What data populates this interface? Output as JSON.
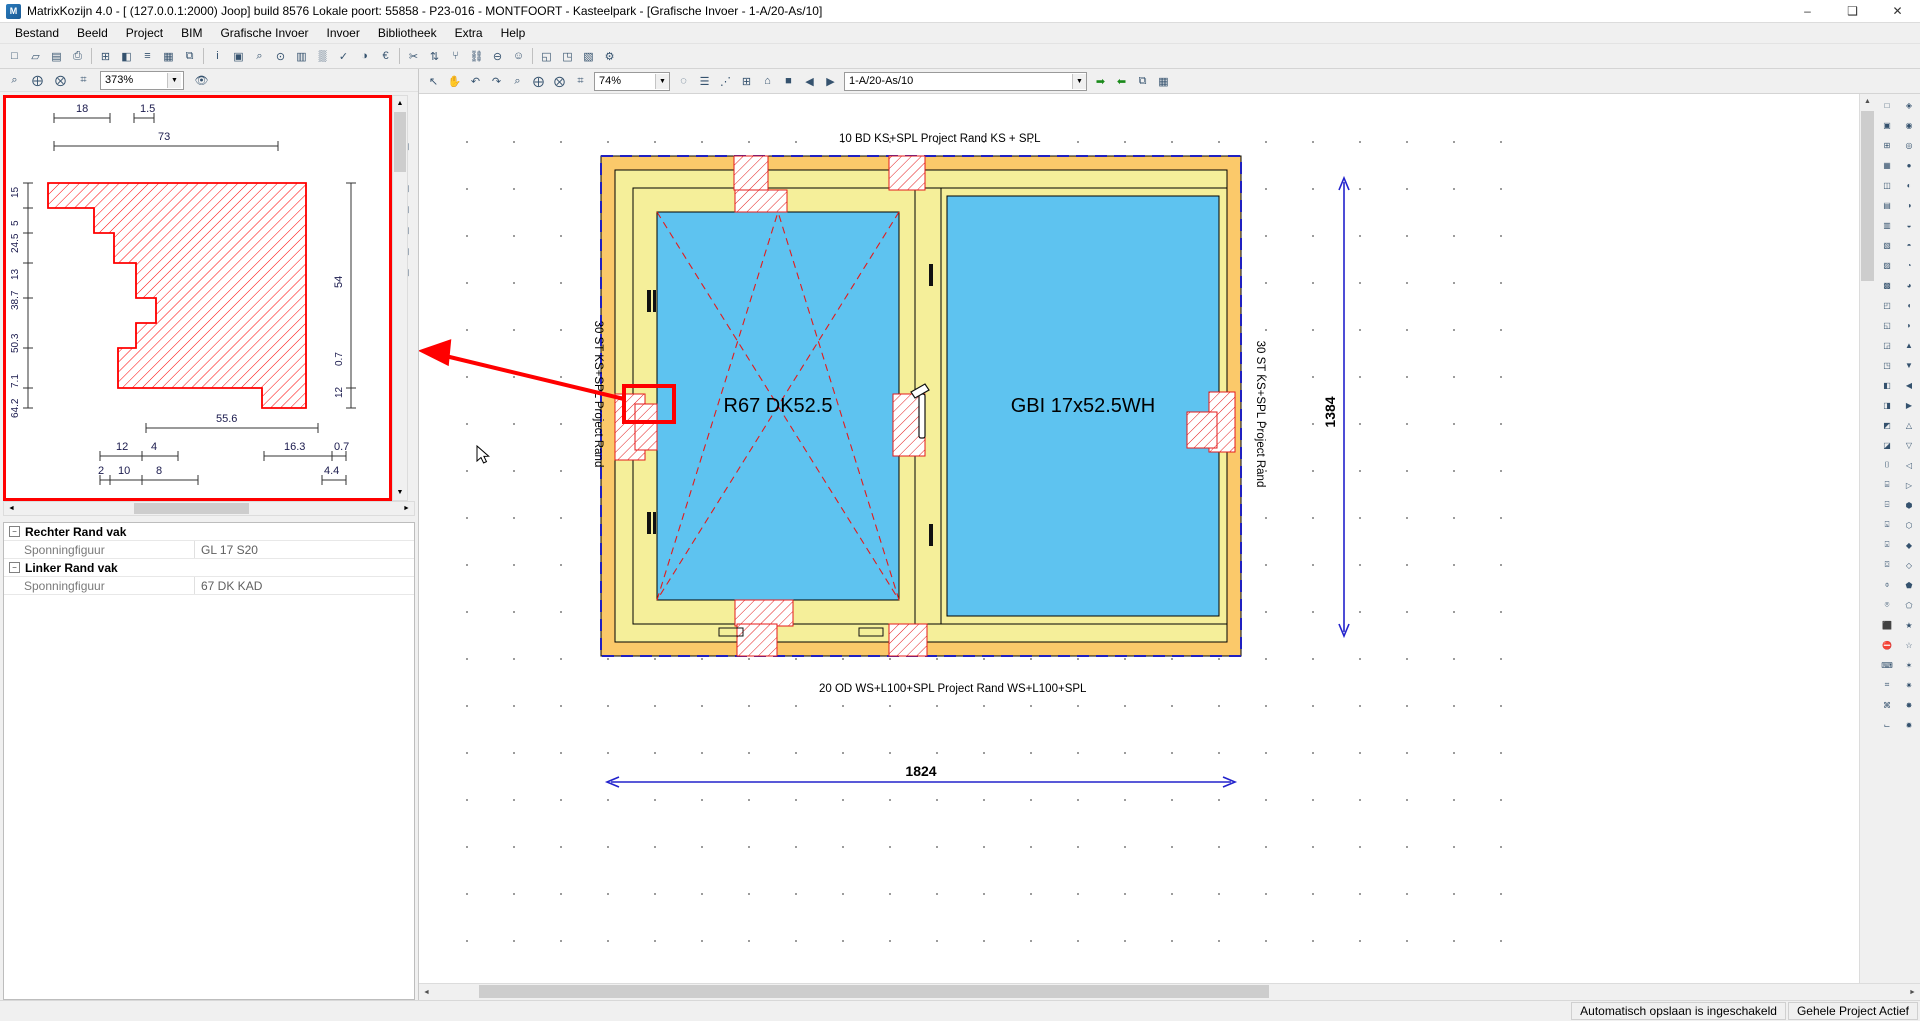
{
  "window": {
    "title": "MatrixKozijn 4.0 - [ (127.0.0.1:2000) Joop] build  8576 Lokale poort: 55858 - P23-016 - MONTFOORT - Kasteelpark - [Grafische Invoer - 1-A/20-As/10]",
    "app_icon": "app-icon",
    "minimize": "–",
    "maximize": "❑",
    "close": "✕"
  },
  "menubar": {
    "items": [
      {
        "label": "Bestand"
      },
      {
        "label": "Beeld"
      },
      {
        "label": "Project"
      },
      {
        "label": "BIM"
      },
      {
        "label": "Grafische Invoer"
      },
      {
        "label": "Invoer"
      },
      {
        "label": "Bibliotheek"
      },
      {
        "label": "Extra"
      },
      {
        "label": "Help"
      }
    ]
  },
  "main_toolbar": {
    "buttons": [
      {
        "name": "new-document-icon",
        "glyph": "□"
      },
      {
        "name": "open-folder-icon",
        "glyph": "▱"
      },
      {
        "name": "save-icon",
        "glyph": "▤"
      },
      {
        "name": "print-icon",
        "glyph": "⎙"
      },
      {
        "name": "sep",
        "glyph": ""
      },
      {
        "name": "grid-view-icon",
        "glyph": "⊞"
      },
      {
        "name": "chart-icon",
        "glyph": "◧"
      },
      {
        "name": "list-icon",
        "glyph": "≡"
      },
      {
        "name": "table-icon",
        "glyph": "▦"
      },
      {
        "name": "copy-icon",
        "glyph": "⧉"
      },
      {
        "name": "sep",
        "glyph": ""
      },
      {
        "name": "info-icon",
        "glyph": "i"
      },
      {
        "name": "calculator-icon",
        "glyph": "▣"
      },
      {
        "name": "zoom-page-icon",
        "glyph": "⌕"
      },
      {
        "name": "search-doc-icon",
        "glyph": "⊙"
      },
      {
        "name": "report-icon",
        "glyph": "▥"
      },
      {
        "name": "color-icon",
        "glyph": "▒"
      },
      {
        "name": "spell-icon",
        "glyph": "✓"
      },
      {
        "name": "palette-icon",
        "glyph": "◑"
      },
      {
        "name": "euro-icon",
        "glyph": "€"
      },
      {
        "name": "sep",
        "glyph": ""
      },
      {
        "name": "cut-icon",
        "glyph": "✂"
      },
      {
        "name": "sort-icon",
        "glyph": "⇅"
      },
      {
        "name": "tree-icon",
        "glyph": "⑂"
      },
      {
        "name": "link-icon",
        "glyph": "⛓"
      },
      {
        "name": "attach-icon",
        "glyph": "⊖"
      },
      {
        "name": "user-icon",
        "glyph": "☺"
      },
      {
        "name": "sep",
        "glyph": ""
      },
      {
        "name": "window-icon",
        "glyph": "◱"
      },
      {
        "name": "export-icon",
        "glyph": "◳"
      },
      {
        "name": "note-icon",
        "glyph": "▧"
      },
      {
        "name": "gear-icon",
        "glyph": "⚙"
      }
    ]
  },
  "left_panel": {
    "toolbar": [
      {
        "name": "zoom-extents-icon",
        "glyph": "⌕"
      },
      {
        "name": "zoom-in-icon",
        "glyph": "⨁"
      },
      {
        "name": "zoom-out-icon",
        "glyph": "⨂"
      },
      {
        "name": "zoom-window-icon",
        "glyph": "⌗"
      }
    ],
    "zoom_value": "373%",
    "eye_icon": "eye-icon",
    "profile_drawing": {
      "top_dims": [
        "18",
        "1.5",
        "73"
      ],
      "left_dims": [
        "15",
        "5",
        "24.5",
        "13",
        "38.7",
        "50.3",
        "7.1",
        "64.2"
      ],
      "right_dims": [
        "54",
        "0.7",
        "12"
      ],
      "bottom_dims_row1": [
        "55.6"
      ],
      "bottom_dims_row2": [
        "12",
        "4",
        "16.3",
        "0.7"
      ],
      "bottom_dims_row3": [
        "2",
        "10",
        "8",
        "4.4"
      ]
    }
  },
  "properties": {
    "groups": [
      {
        "title": "Rechter Rand vak",
        "expander": "−",
        "rows": [
          {
            "key": "Sponningfiguur",
            "value": "GL 17 S20"
          }
        ]
      },
      {
        "title": "Linker Rand vak",
        "expander": "−",
        "rows": [
          {
            "key": "Sponningfiguur",
            "value": "67 DK KAD"
          }
        ]
      }
    ]
  },
  "draw_toolbar": {
    "left_buttons": [
      {
        "name": "select-arrow-icon",
        "glyph": "↖"
      },
      {
        "name": "pan-hand-icon",
        "glyph": "✋"
      },
      {
        "name": "undo-icon",
        "glyph": "↶"
      },
      {
        "name": "redo-icon",
        "glyph": "↷"
      },
      {
        "name": "zoom-extents-icon",
        "glyph": "⌕"
      },
      {
        "name": "zoom-in-icon",
        "glyph": "⨁"
      },
      {
        "name": "zoom-out-icon",
        "glyph": "⨂"
      },
      {
        "name": "zoom-window-icon",
        "glyph": "⌗"
      }
    ],
    "zoom_value": "74%",
    "mid_buttons": [
      {
        "name": "globe-icon",
        "glyph": "◌"
      },
      {
        "name": "layers-icon",
        "glyph": "☰"
      },
      {
        "name": "grid-snap-icon",
        "glyph": "⋰"
      },
      {
        "name": "grid-icon",
        "glyph": "⊞"
      },
      {
        "name": "home-icon",
        "glyph": "⌂"
      },
      {
        "name": "color-swatch-icon",
        "glyph": "■"
      }
    ],
    "nav_prev": "◀",
    "nav_next": "▶",
    "element_selector": "1-A/20-As/10",
    "right_buttons": [
      {
        "name": "arrow-right-green-icon",
        "glyph": "➡"
      },
      {
        "name": "arrow-left-green-icon",
        "glyph": "➡"
      },
      {
        "name": "copy-view-icon",
        "glyph": "⧉"
      },
      {
        "name": "paste-view-icon",
        "glyph": "▦"
      }
    ]
  },
  "drawing": {
    "label_top": "10 BD KS+SPL Project Rand KS + SPL",
    "label_bottom": "20 OD WS+L100+SPL Project Rand WS+L100+SPL",
    "label_left": "30 ST KS+SPL Project Rand",
    "label_right": "30 ST KS+SPL Project Rand",
    "panel_left": "R67 DK52.5",
    "panel_right": "GBI 17x52.5WH",
    "dim_height": "1384",
    "dim_width": "1824",
    "colors": {
      "frame": "#f5ef9a",
      "frame_outer": "#fbc96a",
      "glass": "#5ec3f0",
      "hatch": "#e41b1b",
      "outline": "#000000",
      "dash_blue": "#2020c0",
      "dim_blue": "#2222cc",
      "highlight_red": "#ff0000"
    }
  },
  "right_rail": {
    "buttons": [
      {
        "name": "rail-icon-1",
        "glyph": "□"
      },
      {
        "name": "rail-icon-2",
        "glyph": "▣"
      },
      {
        "name": "rail-icon-3",
        "glyph": "⊞"
      },
      {
        "name": "rail-icon-4",
        "glyph": "▦"
      },
      {
        "name": "rail-icon-5",
        "glyph": "◫"
      },
      {
        "name": "rail-icon-6",
        "glyph": "▤"
      },
      {
        "name": "rail-icon-7",
        "glyph": "▥"
      },
      {
        "name": "rail-icon-8",
        "glyph": "▧"
      },
      {
        "name": "rail-icon-9",
        "glyph": "▨"
      },
      {
        "name": "rail-icon-10",
        "glyph": "▩"
      },
      {
        "name": "rail-icon-11",
        "glyph": "◰"
      },
      {
        "name": "rail-icon-12",
        "glyph": "◱"
      },
      {
        "name": "rail-icon-13",
        "glyph": "◲"
      },
      {
        "name": "rail-icon-14",
        "glyph": "◳"
      },
      {
        "name": "rail-icon-15",
        "glyph": "◧"
      },
      {
        "name": "rail-icon-16",
        "glyph": "◨"
      },
      {
        "name": "rail-icon-17",
        "glyph": "◩"
      },
      {
        "name": "rail-icon-18",
        "glyph": "◪"
      },
      {
        "name": "rail-icon-19",
        "glyph": "⌷"
      },
      {
        "name": "rail-icon-20",
        "glyph": "⌸"
      },
      {
        "name": "rail-icon-21",
        "glyph": "⌹"
      },
      {
        "name": "rail-icon-22",
        "glyph": "⌺"
      },
      {
        "name": "rail-icon-23",
        "glyph": "⌻"
      },
      {
        "name": "rail-icon-24",
        "glyph": "⌼"
      },
      {
        "name": "rail-icon-25",
        "glyph": "⌽"
      },
      {
        "name": "rail-icon-26",
        "glyph": "⌾"
      },
      {
        "name": "rail-icon-27",
        "glyph": "⬛"
      },
      {
        "name": "rail-icon-28",
        "glyph": "⛔"
      },
      {
        "name": "rail-icon-29",
        "glyph": "⌨"
      },
      {
        "name": "rail-icon-30",
        "glyph": "⌗"
      },
      {
        "name": "rail-icon-31",
        "glyph": "⌘"
      },
      {
        "name": "rail-icon-32",
        "glyph": "⌙"
      }
    ],
    "buttons2": [
      {
        "name": "rail2-icon-1",
        "glyph": "◈"
      },
      {
        "name": "rail2-icon-2",
        "glyph": "◉"
      },
      {
        "name": "rail2-icon-3",
        "glyph": "◎"
      },
      {
        "name": "rail2-icon-4",
        "glyph": "●"
      },
      {
        "name": "rail2-icon-5",
        "glyph": "◐"
      },
      {
        "name": "rail2-icon-6",
        "glyph": "◑"
      },
      {
        "name": "rail2-icon-7",
        "glyph": "◒"
      },
      {
        "name": "rail2-icon-8",
        "glyph": "◓"
      },
      {
        "name": "rail2-icon-9",
        "glyph": "◔"
      },
      {
        "name": "rail2-icon-10",
        "glyph": "◕"
      },
      {
        "name": "rail2-icon-11",
        "glyph": "◖"
      },
      {
        "name": "rail2-icon-12",
        "glyph": "◗"
      },
      {
        "name": "rail2-icon-13",
        "glyph": "▲"
      },
      {
        "name": "rail2-icon-14",
        "glyph": "▼"
      },
      {
        "name": "rail2-icon-15",
        "glyph": "◀"
      },
      {
        "name": "rail2-icon-16",
        "glyph": "▶"
      },
      {
        "name": "rail2-icon-17",
        "glyph": "△"
      },
      {
        "name": "rail2-icon-18",
        "glyph": "▽"
      },
      {
        "name": "rail2-icon-19",
        "glyph": "◁"
      },
      {
        "name": "rail2-icon-20",
        "glyph": "▷"
      },
      {
        "name": "rail2-icon-21",
        "glyph": "⬢"
      },
      {
        "name": "rail2-icon-22",
        "glyph": "⬡"
      },
      {
        "name": "rail2-icon-23",
        "glyph": "◆"
      },
      {
        "name": "rail2-icon-24",
        "glyph": "◇"
      },
      {
        "name": "rail2-icon-25",
        "glyph": "⬟"
      },
      {
        "name": "rail2-icon-26",
        "glyph": "⬠"
      },
      {
        "name": "rail2-icon-27",
        "glyph": "★"
      },
      {
        "name": "rail2-icon-28",
        "glyph": "☆"
      },
      {
        "name": "rail2-icon-29",
        "glyph": "✶"
      },
      {
        "name": "rail2-icon-30",
        "glyph": "✷"
      },
      {
        "name": "rail2-icon-31",
        "glyph": "✸"
      },
      {
        "name": "rail2-icon-32",
        "glyph": "✹"
      }
    ]
  },
  "statusbar": {
    "autosave": "Automatisch opslaan is ingeschakeld",
    "project_state": "Gehele Project Actief"
  }
}
